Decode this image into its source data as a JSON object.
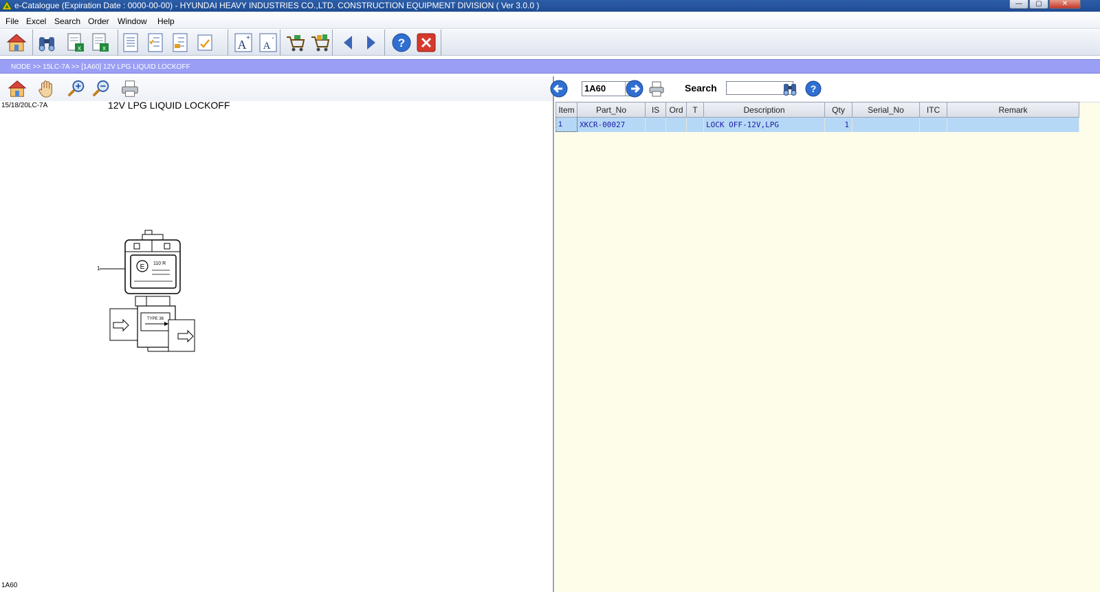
{
  "window": {
    "title": "e-Catalogue (Expiration Date : 0000-00-00)  -  HYUNDAI HEAVY INDUSTRIES CO.,LTD. CONSTRUCTION EQUIPMENT DIVISION ( Ver 3.0.0 )"
  },
  "menu": {
    "items": [
      {
        "label": "File"
      },
      {
        "label": "Excel"
      },
      {
        "label": "Search"
      },
      {
        "label": "Order"
      },
      {
        "label": "Window"
      },
      {
        "label": "Help"
      }
    ]
  },
  "toolbar": {
    "icons": [
      "home-icon",
      "binoculars-icon",
      "excel-export-icon",
      "excel-export-2-icon",
      "document-icon",
      "document-list-icon",
      "document-list-2-icon",
      "image-icon",
      "font-increase-icon",
      "font-decrease-icon",
      "cart-icon",
      "cart-full-icon",
      "back-arrow-icon",
      "forward-arrow-icon",
      "help-icon",
      "close-icon"
    ]
  },
  "breadcrumb": {
    "text": "NODE >> 15LC-7A >> [1A60] 12V LPG LIQUID LOCKOFF"
  },
  "left_panel": {
    "model": "15/18/20LC-7A",
    "drawing_title": "12V LPG LIQUID LOCKOFF",
    "page_code": "1A60",
    "diagram": {
      "callout": "1",
      "label_110r": "110 R",
      "label_type": "TYPE 36"
    }
  },
  "right_panel": {
    "page_select": "1A60",
    "search_label": "Search",
    "search_value": "",
    "table": {
      "columns": [
        "Item",
        "Part_No",
        "IS",
        "Ord",
        "T",
        "Description",
        "Qty",
        "Serial_No",
        "ITC",
        "Remark"
      ],
      "rows": [
        {
          "item": "1",
          "part_no": "XKCR-00027",
          "is": "",
          "ord": "",
          "t": "",
          "description": "LOCK OFF-12V,LPG",
          "qty": "1",
          "serial_no": "",
          "itc": "",
          "remark": ""
        }
      ]
    }
  },
  "colors": {
    "titlebar": "#1f4d94",
    "breadcrumb": "#9a9ef5",
    "table_bg": "#fefde9",
    "row_selected": "#b6d8f7"
  }
}
